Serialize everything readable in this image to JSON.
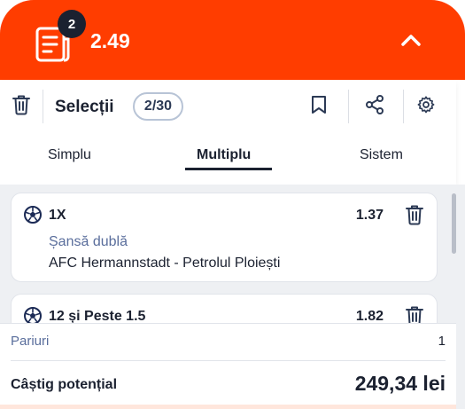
{
  "header": {
    "badge_count": "2",
    "total_odds": "2.49",
    "bg_color": "#ff3d00",
    "icons": {
      "slip": "betslip-icon",
      "collapse": "chevron-up-icon"
    }
  },
  "toolbar": {
    "title": "Selecții",
    "count": "2/30",
    "icons": [
      "trash-icon",
      "bookmark-icon",
      "share-icon",
      "gear-icon"
    ]
  },
  "tabs": [
    {
      "label": "Simplu",
      "active": false
    },
    {
      "label": "Multiplu",
      "active": true
    },
    {
      "label": "Sistem",
      "active": false
    }
  ],
  "selections": [
    {
      "pick": "1X",
      "odd": "1.37",
      "market": "Șansă dublă",
      "event": "AFC Hermannstadt - Petrolul Ploiești",
      "icon": "football-icon"
    },
    {
      "pick": "12 și Peste 1.5",
      "odd": "1.82",
      "icon": "football-icon"
    }
  ],
  "summary": {
    "bets_label": "Pariuri",
    "bets_value": "1",
    "win_label": "Câștig potențial",
    "win_value": "249,34 lei"
  }
}
